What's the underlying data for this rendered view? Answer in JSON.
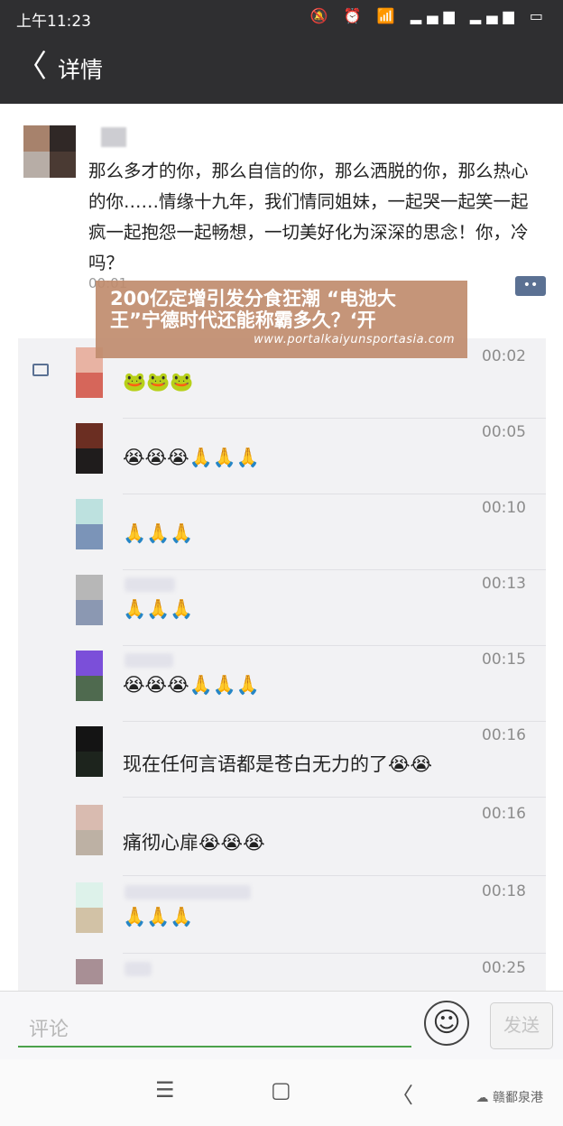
{
  "status_bar": {
    "time": "上午11:23",
    "icons": "🔕 ⏰ 📶 ▂▄▆ ▂▄▆ ▭"
  },
  "app_bar": {
    "back": "〈",
    "title": "详情"
  },
  "post": {
    "text": "那么多才的你，那么自信的你，那么洒脱的你，那么热心的你……情缘十九年，我们情同姐妹，一起哭一起笑一起疯一起抱怨一起畅想，一切美好化为深深的思念！你，冷吗？",
    "time": "00:01",
    "comment_button": "••"
  },
  "overlay": {
    "line1": "200亿定增引发分食狂潮 “电池大",
    "line2": "王”宁德时代还能称霸多久？‘开",
    "url": "www.portalkaiyunsportasia.com"
  },
  "comments": [
    {
      "time": "00:02",
      "text": "🐸🐸🐸",
      "top_color": "#e8b3a3",
      "bottom_color": "#d6665a",
      "name_w": 0
    },
    {
      "time": "00:05",
      "text": "😭😭😭🙏🙏🙏",
      "top_color": "#6b2e22",
      "bottom_color": "#1f1c1c",
      "name_w": 0
    },
    {
      "time": "00:10",
      "text": "🙏🙏🙏",
      "top_color": "#bde1df",
      "bottom_color": "#7b94b8",
      "name_w": 0
    },
    {
      "time": "00:13",
      "text": "🙏🙏🙏",
      "top_color": "#b7b7b7",
      "bottom_color": "#8b98b2",
      "name_w": 56
    },
    {
      "time": "00:15",
      "text": "😭😭😭🙏🙏🙏",
      "top_color": "#7b4fd9",
      "bottom_color": "#4f6a4f",
      "name_w": 54
    },
    {
      "time": "00:16",
      "text": "现在任何言语都是苍白无力的了😭😭",
      "top_color": "#141414",
      "bottom_color": "#1d241d",
      "name_w": 0
    },
    {
      "time": "00:16",
      "text": "痛彻心扉😭😭😭",
      "top_color": "#d9bbb0",
      "bottom_color": "#bdb1a4",
      "name_w": 0
    },
    {
      "time": "00:18",
      "text": "🙏🙏🙏",
      "top_color": "#ddf2ea",
      "bottom_color": "#d2c2a6",
      "name_w": 140
    },
    {
      "time": "00:25",
      "text": "",
      "top_color": "#a88f95",
      "bottom_color": "#f2f2f4",
      "name_w": 30
    }
  ],
  "composer": {
    "placeholder": "评论",
    "send_label": "发送",
    "emoji_icon": "☺"
  },
  "nav_bar": {
    "menu": "☰",
    "home": "▢",
    "back": "〈",
    "brand": "☁ 赣鄱泉港"
  }
}
